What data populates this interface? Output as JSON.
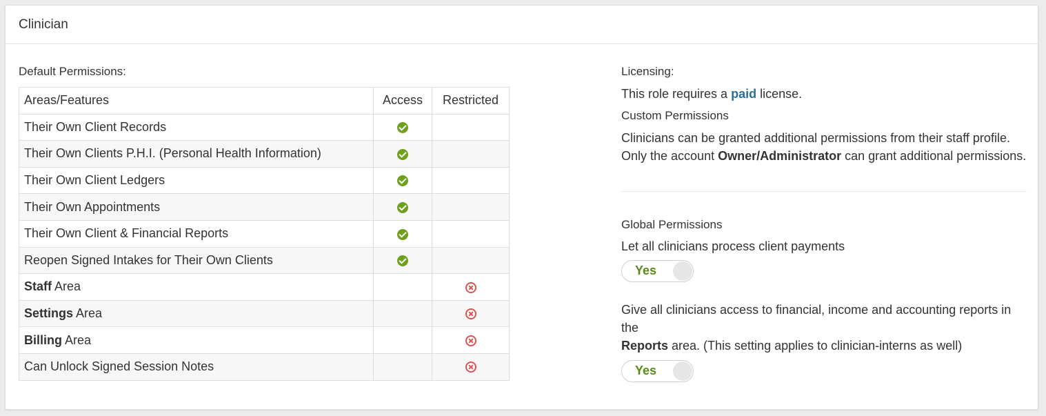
{
  "panel": {
    "title": "Clinician"
  },
  "default_permissions": {
    "label": "Default Permissions:",
    "columns": [
      "Areas/Features",
      "Access",
      "Restricted"
    ],
    "rows": [
      {
        "bold": "",
        "text": "Their Own Client Records",
        "access": true,
        "restricted": false
      },
      {
        "bold": "",
        "text": "Their Own Clients P.H.I. (Personal Health Information)",
        "access": true,
        "restricted": false
      },
      {
        "bold": "",
        "text": "Their Own Client Ledgers",
        "access": true,
        "restricted": false
      },
      {
        "bold": "",
        "text": "Their Own Appointments",
        "access": true,
        "restricted": false
      },
      {
        "bold": "",
        "text": "Their Own Client & Financial Reports",
        "access": true,
        "restricted": false
      },
      {
        "bold": "",
        "text": "Reopen Signed Intakes for Their Own Clients",
        "access": true,
        "restricted": false
      },
      {
        "bold": "Staff",
        "text": " Area",
        "access": false,
        "restricted": true
      },
      {
        "bold": "Settings",
        "text": " Area",
        "access": false,
        "restricted": true
      },
      {
        "bold": "Billing",
        "text": " Area",
        "access": false,
        "restricted": true
      },
      {
        "bold": "",
        "text": "Can Unlock Signed Session Notes",
        "access": false,
        "restricted": true
      }
    ],
    "icons": {
      "access": "check-circle-icon",
      "restricted": "x-circle-icon"
    },
    "colors": {
      "check": "#6fa01b",
      "restricted": "#d9534f"
    }
  },
  "licensing": {
    "label": "Licensing:",
    "text_before": "This role requires a ",
    "highlight": "paid",
    "text_after": " license.",
    "highlight_color": "#2a6f97"
  },
  "custom_permissions": {
    "label": "Custom Permissions",
    "line1": "Clinicians can be granted additional permissions from their staff profile.",
    "line2_before": "Only the account ",
    "line2_bold": "Owner/Administrator",
    "line2_after": " can grant additional permissions."
  },
  "global_permissions": {
    "label": "Global Permissions",
    "setting1": {
      "text": "Let all clinicians process client payments",
      "toggle": "Yes"
    },
    "setting2": {
      "line1": "Give all clinicians access to financial, income and accounting reports in the",
      "line2_bold": "Reports",
      "line2_after": " area. (This setting applies to clinician-interns as well)",
      "toggle": "Yes"
    },
    "toggle_color": "#5a8a1a"
  }
}
